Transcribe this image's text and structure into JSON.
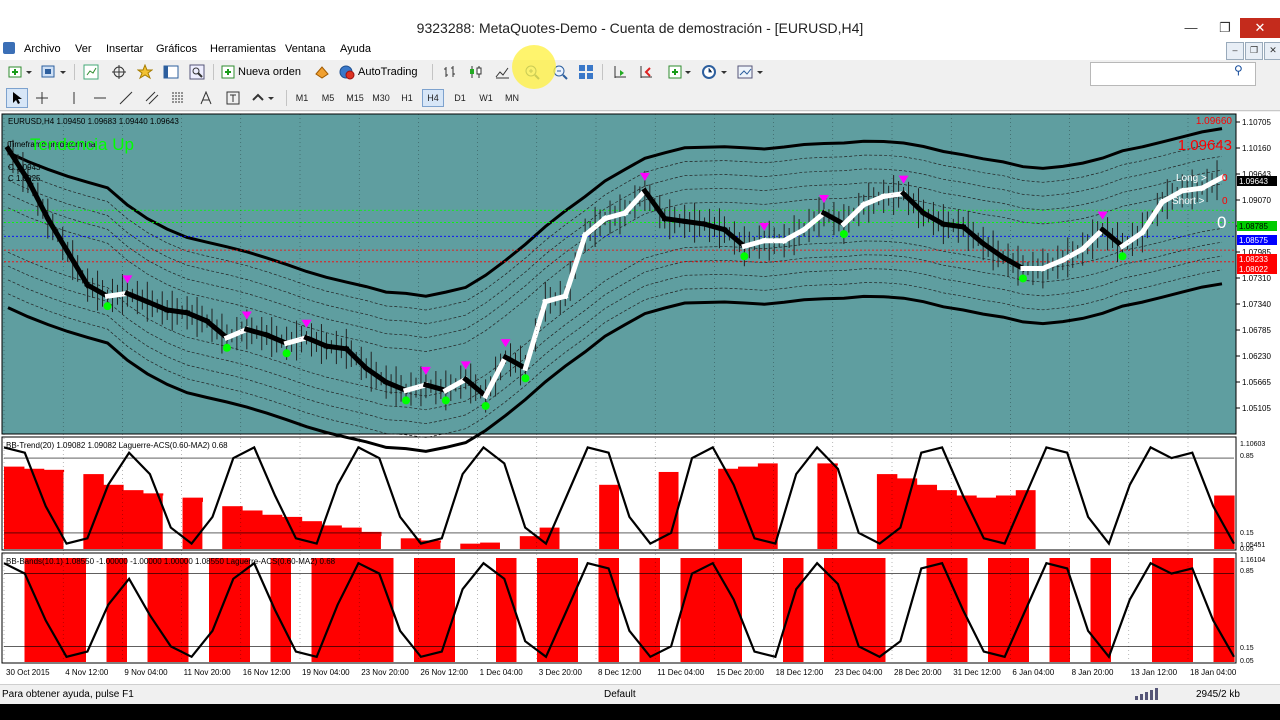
{
  "window": {
    "title": "9323288: MetaQuotes-Demo - Cuenta de demostración - [EURUSD,H4]",
    "min": "—",
    "max": "❐",
    "close": "✕",
    "mdi_min": "–",
    "mdi_restore": "❐",
    "mdi_close": "✕"
  },
  "menu": [
    "Archivo",
    "Ver",
    "Insertar",
    "Gráficos",
    "Herramientas",
    "Ventana",
    "Ayuda"
  ],
  "toolbar": {
    "new_order": "Nueva orden",
    "autotrading": "AutoTrading",
    "search_placeholder": ""
  },
  "timeframes": [
    {
      "label": "M1",
      "active": false
    },
    {
      "label": "M5",
      "active": false
    },
    {
      "label": "M15",
      "active": false
    },
    {
      "label": "M30",
      "active": false
    },
    {
      "label": "H1",
      "active": false
    },
    {
      "label": "H4",
      "active": true
    },
    {
      "label": "D1",
      "active": false
    },
    {
      "label": "W1",
      "active": false
    },
    {
      "label": "MN",
      "active": false
    }
  ],
  "colors": {
    "chart_bg": "#5f9ea0",
    "bull_marker": "#00ff00",
    "bear_marker": "#ff00ff",
    "hist_red": "#ff0000",
    "hist_white": "#ffffff",
    "down_price": "#ff0000"
  },
  "chart_data": [
    {
      "type": "line",
      "title": "EURUSD,H4 1.09450 1.09683 1.09440 1.09643",
      "symbol": "EURUSD",
      "timeframe": "H4",
      "ohlc": {
        "open": 1.0945,
        "high": 1.09683,
        "low": 1.0944,
        "close": 1.09643
      },
      "overlay_text": "Tendencia Up",
      "info_lines": [
        "Timeframe predetermina",
        "C 1.0943",
        "C 1.0925"
      ],
      "ylim": [
        1.0505,
        1.0725
      ],
      "y_ticks": [
        1.10705,
        1.1016,
        1.09643,
        1.0907,
        1.08525,
        1.07985,
        1.0731,
        1.0734,
        1.06785,
        1.0623,
        1.05665,
        1.05105
      ],
      "price_labels": [
        {
          "text": "1.09643",
          "kind": "bid"
        },
        {
          "text": "1.08785",
          "kind": "green"
        },
        {
          "text": "1.08575",
          "kind": "blue"
        },
        {
          "text": "1.08233",
          "kind": "red"
        },
        {
          "text": "1.08022",
          "kind": "red"
        }
      ],
      "corner": {
        "price_big": "1.09643",
        "price_small": "1.09660",
        "long": "Long >",
        "short": "Short >",
        "long_val": "0",
        "short_val": "0",
        "zero": "0"
      },
      "x_labels": [
        "30 Oct 2015",
        "4 Nov 12:00",
        "9 Nov 04:00",
        "11 Nov 20:00",
        "16 Nov 12:00",
        "19 Nov 04:00",
        "23 Nov 20:00",
        "26 Nov 12:00",
        "1 Dec 04:00",
        "3 Dec 20:00",
        "8 Dec 12:00",
        "11 Dec 04:00",
        "15 Dec 20:00",
        "18 Dec 12:00",
        "23 Dec 04:00",
        "28 Dec 20:00",
        "31 Dec 12:00",
        "6 Jan 04:00",
        "8 Jan 20:00",
        "13 Jan 12:00",
        "18 Jan 04:00"
      ],
      "series": [
        {
          "values": [
            1.1016,
            1.096,
            1.089,
            1.083,
            1.077,
            1.075,
            1.0755,
            1.074,
            1.0725,
            1.072,
            1.0705,
            1.0675,
            1.069,
            1.068,
            1.0665,
            1.0675,
            1.066,
            1.0655,
            1.062,
            1.0595,
            1.058,
            1.059,
            1.058,
            1.06,
            1.057,
            1.064,
            1.062,
            1.074,
            1.075,
            1.086,
            1.089,
            1.09,
            1.094,
            1.089,
            1.0885,
            1.088,
            1.087,
            1.084,
            1.085,
            1.085,
            1.087,
            1.09,
            1.088,
            1.0915,
            1.093,
            1.0935,
            1.09,
            1.088,
            1.0875,
            1.0845,
            1.082,
            1.08,
            1.08,
            1.0815,
            1.0835,
            1.087,
            1.084,
            1.0865,
            1.092,
            1.094,
            1.0945,
            1.0964
          ]
        }
      ]
    },
    {
      "type": "area",
      "title": "BB-Trend(20) 1.09082 1.09082 Laguerre-ACS(0.60-MA2) 0.68",
      "ylim": [
        1.05451,
        1.10603
      ],
      "y_labels": [
        "1.10603",
        "0.85",
        "0.15",
        "1.05451",
        "0.05"
      ],
      "hist": [
        0.77,
        0.75,
        0.74,
        0.72,
        0.7,
        0.6,
        0.55,
        0.52,
        0.5,
        0.48,
        0.44,
        0.4,
        0.36,
        0.32,
        0.3,
        0.26,
        0.22,
        0.2,
        0.16,
        0.12,
        0.1,
        0.08,
        0.06,
        0.05,
        0.06,
        0.08,
        0.12,
        0.2,
        0.35,
        0.5,
        0.6,
        0.65,
        0.7,
        0.72,
        0.72,
        0.73,
        0.75,
        0.77,
        0.8,
        0.82,
        0.82,
        0.8,
        0.78,
        0.75,
        0.7,
        0.66,
        0.6,
        0.55,
        0.5,
        0.48,
        0.5,
        0.55,
        0.58,
        0.62,
        0.64,
        0.63,
        0.6,
        0.58,
        0.56,
        0.54,
        0.52,
        0.5
      ],
      "hist_red": [
        true,
        true,
        true,
        false,
        true,
        true,
        true,
        true,
        false,
        true,
        false,
        true,
        true,
        true,
        true,
        true,
        true,
        true,
        true,
        false,
        true,
        true,
        false,
        true,
        true,
        false,
        true,
        true,
        false,
        false,
        true,
        false,
        false,
        true,
        false,
        false,
        true,
        true,
        true,
        false,
        false,
        true,
        false,
        false,
        true,
        true,
        true,
        true,
        true,
        true,
        true,
        true,
        false,
        false,
        false,
        false,
        false,
        false,
        false,
        false,
        false,
        true
      ],
      "osc": [
        0.95,
        0.9,
        0.4,
        0.05,
        0.1,
        0.6,
        0.9,
        0.7,
        0.2,
        0.05,
        0.3,
        0.85,
        0.95,
        0.5,
        0.1,
        0.05,
        0.6,
        0.95,
        0.85,
        0.3,
        0.05,
        0.1,
        0.7,
        0.95,
        0.8,
        0.2,
        0.05,
        0.5,
        0.95,
        0.9,
        0.3,
        0.05,
        0.15,
        0.85,
        0.95,
        0.6,
        0.1,
        0.05,
        0.7,
        0.95,
        0.75,
        0.15,
        0.05,
        0.2,
        0.9,
        0.95,
        0.5,
        0.1,
        0.05,
        0.5,
        0.95,
        0.9,
        0.3,
        0.05,
        0.6,
        0.95,
        0.85,
        0.9,
        0.4,
        0.05
      ]
    },
    {
      "type": "area",
      "title": "BB-Bands(10.1) 1.08550 -1.00000 -1.00000 1.00000 1.08550 Laguerre-ACS(0.60-MA2) 0.68",
      "ylim": [
        1.05,
        1.16104
      ],
      "y_labels": [
        "1.16104",
        "0.85",
        "0.15",
        "0.05"
      ],
      "hist_red": [
        false,
        true,
        true,
        true,
        false,
        true,
        false,
        true,
        true,
        false,
        true,
        true,
        false,
        true,
        false,
        true,
        true,
        true,
        true,
        false,
        true,
        true,
        false,
        false,
        true,
        false,
        true,
        true,
        false,
        true,
        false,
        true,
        false,
        true,
        true,
        true,
        false,
        false,
        true,
        false,
        true,
        true,
        true,
        false,
        false,
        true,
        true,
        false,
        true,
        true,
        false,
        true,
        false,
        true,
        false,
        false,
        true,
        true,
        false,
        true
      ],
      "osc": [
        0.95,
        0.85,
        0.4,
        0.05,
        0.1,
        0.55,
        0.8,
        0.45,
        0.15,
        0.05,
        0.3,
        0.8,
        0.95,
        0.5,
        0.1,
        0.05,
        0.55,
        0.95,
        0.85,
        0.3,
        0.05,
        0.1,
        0.7,
        0.95,
        0.8,
        0.2,
        0.05,
        0.5,
        0.95,
        0.9,
        0.3,
        0.05,
        0.15,
        0.85,
        0.95,
        0.6,
        0.1,
        0.05,
        0.7,
        0.95,
        0.75,
        0.15,
        0.05,
        0.2,
        0.9,
        0.95,
        0.5,
        0.1,
        0.05,
        0.5,
        0.95,
        0.9,
        0.3,
        0.05,
        0.6,
        0.95,
        0.85,
        0.9,
        0.4,
        0.05
      ]
    }
  ],
  "status": {
    "help": "Para obtener ayuda, pulse F1",
    "profile": "Default",
    "traffic": "2945/2 kb"
  }
}
